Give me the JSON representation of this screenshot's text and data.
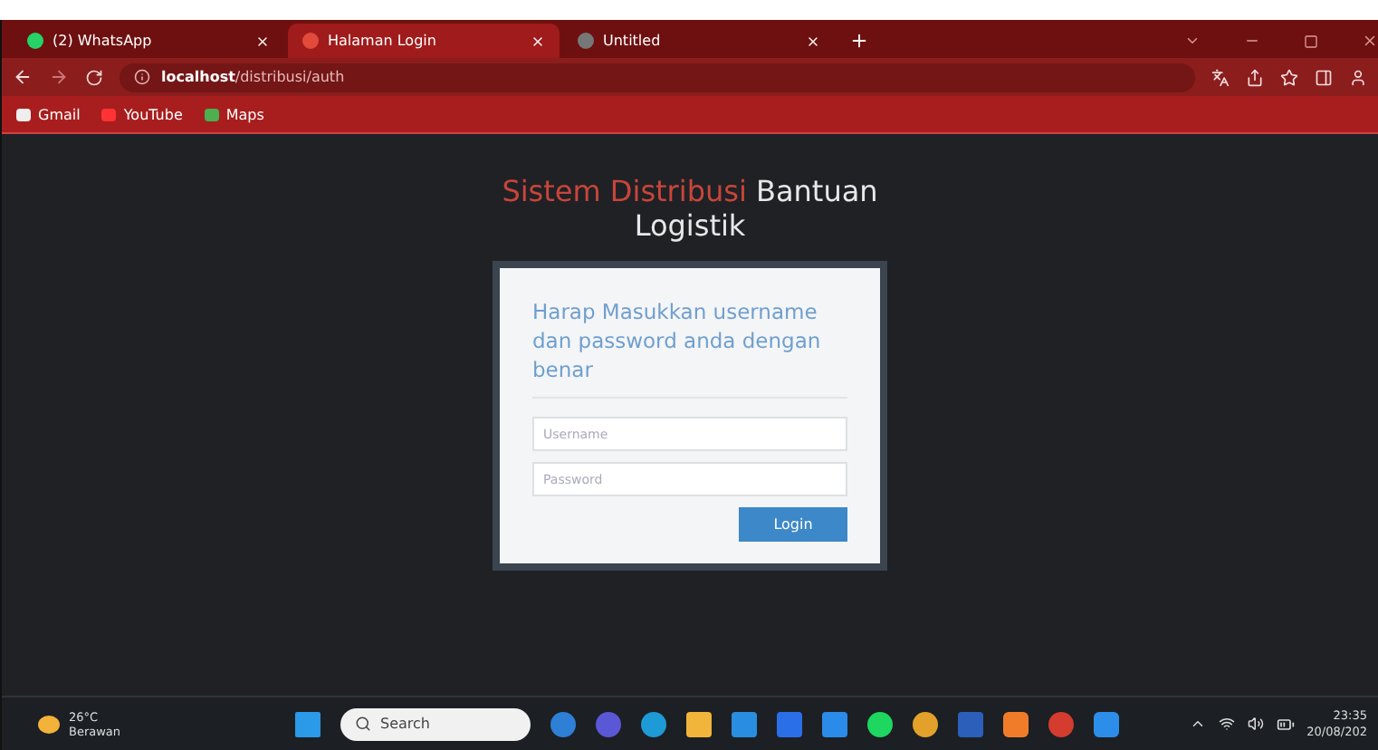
{
  "browser": {
    "tabs": [
      {
        "title": "(2) WhatsApp",
        "selected": false
      },
      {
        "title": "Halaman Login",
        "selected": true
      },
      {
        "title": "Untitled",
        "selected": false
      }
    ],
    "address": "**localhost**/distribusi/auth",
    "bookmarks": [
      "Gmail",
      "YouTube",
      "Maps"
    ]
  },
  "page": {
    "heading": {
      "accent": "Sistem Distribusi",
      "rest": "Bantuan Logistik"
    },
    "login": {
      "prompt": "Harap Masukkan username dan password anda dengan benar",
      "username": {
        "placeholder": "Username"
      },
      "password": {
        "placeholder": "Password"
      },
      "button": "Login"
    }
  },
  "taskbar": {
    "weather": {
      "temperature": "26°C",
      "condition": "Berawan"
    },
    "search": {
      "placeholder": "Search"
    },
    "time": "23:35",
    "date": "20/08/202"
  }
}
